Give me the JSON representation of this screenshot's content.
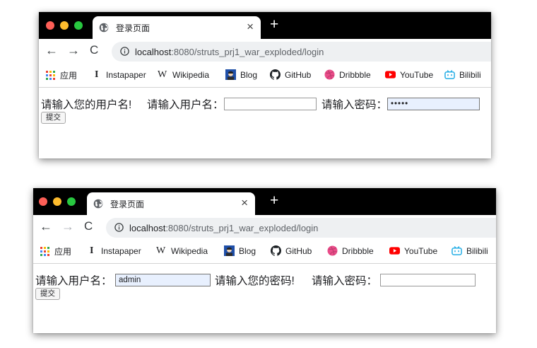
{
  "colors": {
    "titlebar": "#000000",
    "close_dot": "#fe5f57",
    "minimize_dot": "#febc2e",
    "zoom_dot": "#28c840",
    "omnibox_bg": "#eef0f2",
    "autofill_bg": "#e8f0fe"
  },
  "bookmarks": [
    {
      "label": "应用",
      "icon": "apps-grid-icon"
    },
    {
      "label": "Instapaper",
      "icon": "instapaper-icon"
    },
    {
      "label": "Wikipedia",
      "icon": "wikipedia-icon"
    },
    {
      "label": "Blog",
      "icon": "blog-avatar-icon"
    },
    {
      "label": "GitHub",
      "icon": "github-icon"
    },
    {
      "label": "Dribbble",
      "icon": "dribbble-icon"
    },
    {
      "label": "YouTube",
      "icon": "youtube-icon"
    },
    {
      "label": "Bilibili",
      "icon": "bilibili-icon"
    }
  ],
  "icon_glyphs": {
    "instapaper": "I",
    "wikipedia": "W"
  },
  "screenshots": [
    {
      "tab_title": "登录页面",
      "url_host": "localhost",
      "url_path": ":8080/struts_prj1_war_exploded/login",
      "forward_enabled": true,
      "form": {
        "error_username": "请输入您的用户名!",
        "username_label": "请输入用户名：",
        "username_value": "",
        "error_password": "",
        "password_label": "请输入密码：",
        "password_value": "•••••",
        "submit_label": "提交"
      }
    },
    {
      "tab_title": "登录页面",
      "url_host": "localhost",
      "url_path": ":8080/struts_prj1_war_exploded/login",
      "forward_enabled": false,
      "form": {
        "error_username": "",
        "username_label": "请输入用户名：",
        "username_value": "admin",
        "error_password": "请输入您的密码!",
        "password_label": "请输入密码：",
        "password_value": "",
        "submit_label": "提交"
      }
    }
  ]
}
